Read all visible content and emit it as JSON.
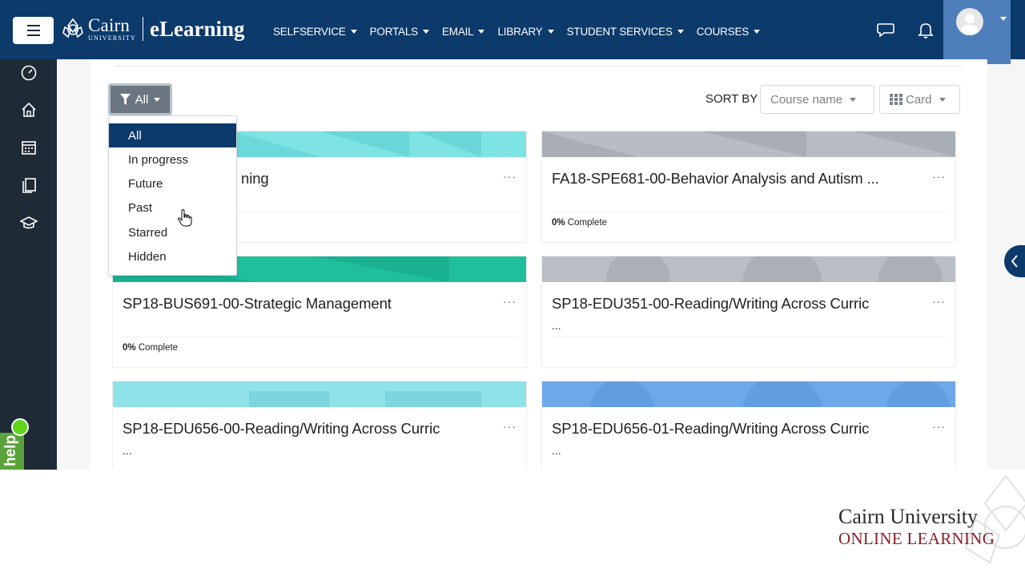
{
  "navbar": {
    "logo_cairn": "Cairn",
    "logo_university": "UNIVERSITY",
    "logo_elearning": "eLearning",
    "menu": [
      "SELFSERVICE",
      "PORTALS",
      "EMAIL",
      "LIBRARY",
      "STUDENT SERVICES",
      "COURSES"
    ]
  },
  "toolbar": {
    "filter_label": "All",
    "sort_by_label": "SORT BY",
    "sort_value": "Course name",
    "view_value": "Card"
  },
  "filter_menu": {
    "items": [
      "All",
      "In progress",
      "Future",
      "Past",
      "Starred",
      "Hidden"
    ],
    "active": "All"
  },
  "courses": [
    {
      "title": "ning",
      "progress_pct": "",
      "progress_text": ""
    },
    {
      "title": "FA18-SPE681-00-Behavior Analysis and Autism ...",
      "progress_pct": "0%",
      "progress_text": "Complete"
    },
    {
      "title": "SP18-BUS691-00-Strategic Management",
      "progress_pct": "0%",
      "progress_text": "Complete"
    },
    {
      "title": "SP18-EDU351-00-Reading/Writing Across Curric",
      "ellipsis": "...",
      "progress_pct": "",
      "progress_text": ""
    },
    {
      "title": "SP18-EDU656-00-Reading/Writing Across Curric",
      "ellipsis": "...",
      "progress_pct": "",
      "progress_text": ""
    },
    {
      "title": "SP18-EDU656-01-Reading/Writing Across Curric",
      "ellipsis": "...",
      "progress_pct": "",
      "progress_text": ""
    }
  ],
  "card_more": "···",
  "help": {
    "label": "help"
  },
  "watermark": {
    "title": "Cairn University",
    "subtitle": "ONLINE LEARNING"
  },
  "colors": {
    "navbar": "#0b3a6b",
    "sidebar": "#1e2a36",
    "accent_user": "#4f7fbb",
    "help_green": "#5aa33a"
  }
}
